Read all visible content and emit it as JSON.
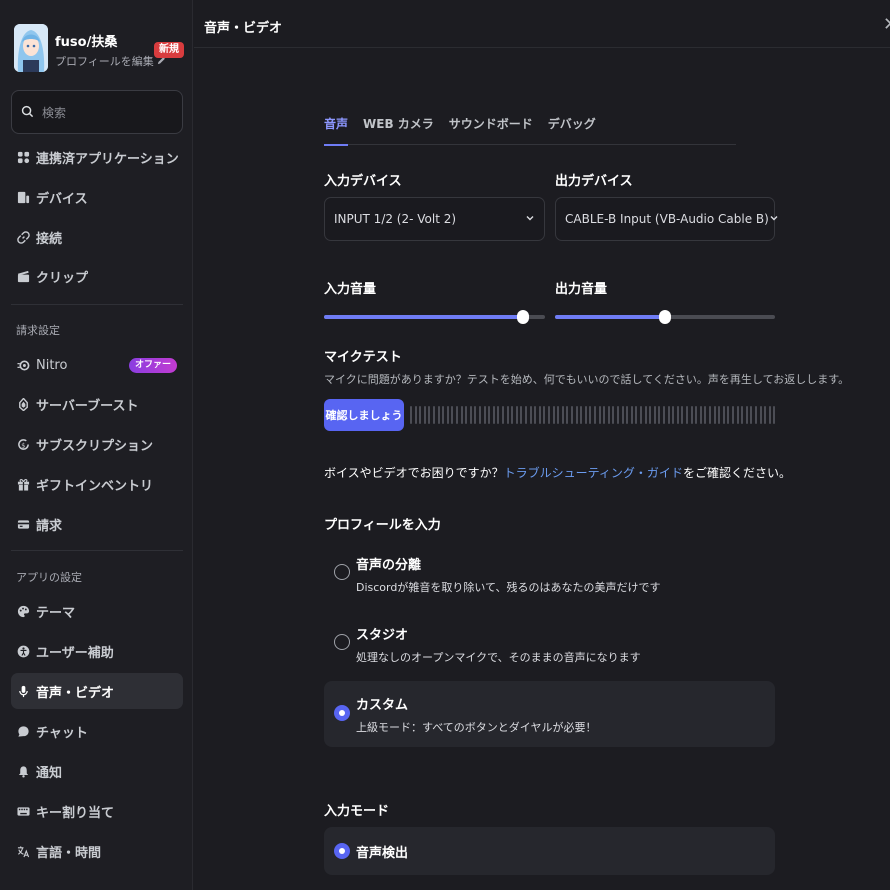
{
  "profile": {
    "username": "fuso/扶桑",
    "edit_label": "プロフィールを編集",
    "new_badge": "新規"
  },
  "search": {
    "placeholder": "検索"
  },
  "sidebar": {
    "items_top": [
      {
        "label": "連携済アプリケーション",
        "icon": "puzzle-icon"
      },
      {
        "label": "デバイス",
        "icon": "devices-icon"
      },
      {
        "label": "接続",
        "icon": "link-icon"
      },
      {
        "label": "クリップ",
        "icon": "clapperboard-icon"
      }
    ],
    "billing_header": "請求設定",
    "billing_items": [
      {
        "label": "Nitro",
        "icon": "nitro-icon",
        "badge": "オファー"
      },
      {
        "label": "サーバーブースト",
        "icon": "boost-icon"
      },
      {
        "label": "サブスクリプション",
        "icon": "subscription-icon"
      },
      {
        "label": "ギフトインベントリ",
        "icon": "gift-icon"
      },
      {
        "label": "請求",
        "icon": "card-icon"
      }
    ],
    "app_header": "アプリの設定",
    "app_items": [
      {
        "label": "テーマ",
        "icon": "palette-icon"
      },
      {
        "label": "ユーザー補助",
        "icon": "accessibility-icon"
      },
      {
        "label": "音声・ビデオ",
        "icon": "microphone-icon",
        "active": true
      },
      {
        "label": "チャット",
        "icon": "chat-icon"
      },
      {
        "label": "通知",
        "icon": "bell-icon"
      },
      {
        "label": "キー割り当て",
        "icon": "keyboard-icon"
      },
      {
        "label": "言語・時間",
        "icon": "translate-icon"
      }
    ]
  },
  "header": {
    "title": "音声・ビデオ"
  },
  "tabs": [
    {
      "label": "音声",
      "active": true
    },
    {
      "label": "WEB カメラ"
    },
    {
      "label": "サウンドボード"
    },
    {
      "label": "デバッグ"
    }
  ],
  "devices": {
    "input_label": "入力デバイス",
    "input_value": "INPUT 1/2 (2- Volt 2)",
    "output_label": "出力デバイス",
    "output_value": "CABLE-B Input (VB-Audio Cable B)"
  },
  "volume": {
    "input_label": "入力音量",
    "input_level": 0.9,
    "output_label": "出力音量",
    "output_level": 0.5
  },
  "mic_test": {
    "title": "マイクテスト",
    "description": "マイクに問題がありますか？テストを始め、何でもいいので話してください。声を再生してお返しします。",
    "button": "確認しましょう"
  },
  "help": {
    "prefix": "ボイスやビデオでお困りですか？",
    "link": "トラブルシューティング・ガイド",
    "suffix": "をご確認ください。"
  },
  "input_profile": {
    "title": "プロフィールを入力",
    "options": [
      {
        "title": "音声の分離",
        "description": "Discordが雑音を取り除いて、残るのはあなたの美声だけです",
        "selected": false
      },
      {
        "title": "スタジオ",
        "description": "処理なしのオープンマイクで、そのままの音声になります",
        "selected": false
      },
      {
        "title": "カスタム",
        "description": "上級モード：すべてのボタンとダイヤルが必要！",
        "selected": true
      }
    ]
  },
  "input_mode": {
    "title": "入力モード",
    "option": "音声検出"
  },
  "colors": {
    "accent": "#5865f2",
    "link": "#6b9cf0",
    "badge_red": "#d83c3e"
  }
}
